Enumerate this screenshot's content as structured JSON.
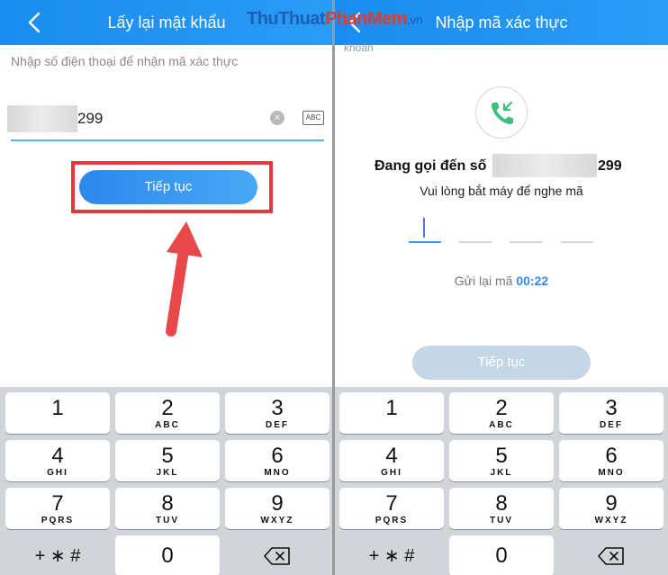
{
  "left_screen": {
    "title": "Lấy lại mật khẩu",
    "hint": "Nhập số điện thoại để nhận mã xác thực",
    "phone_suffix": "299",
    "keyboard_mode_label": "ABC",
    "continue_label": "Tiếp tục",
    "icons": [
      "back-arrow-icon",
      "clear-icon",
      "keyboard-abc-icon",
      "red-arrow-annotation"
    ]
  },
  "right_screen": {
    "title": "Nhập mã xác thực",
    "cut_text": "khoản",
    "calling_label": "Đang gọi đến số",
    "number_suffix": "299",
    "pickup_note": "Vui lòng bắt máy để nghe mã",
    "otp_slots": 4,
    "resend_label": "Gửi lại mã",
    "timer": "00:22",
    "continue_label": "Tiếp tục",
    "icons": [
      "back-arrow-icon",
      "incoming-call-icon"
    ]
  },
  "keyboard": {
    "keys": [
      {
        "num": "1",
        "letters": ""
      },
      {
        "num": "2",
        "letters": "ABC"
      },
      {
        "num": "3",
        "letters": "DEF"
      },
      {
        "num": "4",
        "letters": "GHI"
      },
      {
        "num": "5",
        "letters": "JKL"
      },
      {
        "num": "6",
        "letters": "MNO"
      },
      {
        "num": "7",
        "letters": "PQRS"
      },
      {
        "num": "8",
        "letters": "TUV"
      },
      {
        "num": "9",
        "letters": "WXYZ"
      },
      {
        "num": "0",
        "letters": ""
      }
    ],
    "symbols_label": "+ ∗ #",
    "backspace_icon": "backspace-icon"
  },
  "watermark": {
    "part1": "ThuThuat",
    "part2": "PhanMem",
    "part3": ".vn"
  },
  "colors": {
    "header_blue": "#1a8cf0",
    "highlight_red": "#e23a3a",
    "button_blue": "#2c88ec",
    "disabled_button": "#c5d6e6",
    "timer_blue": "#2a8cf0"
  }
}
